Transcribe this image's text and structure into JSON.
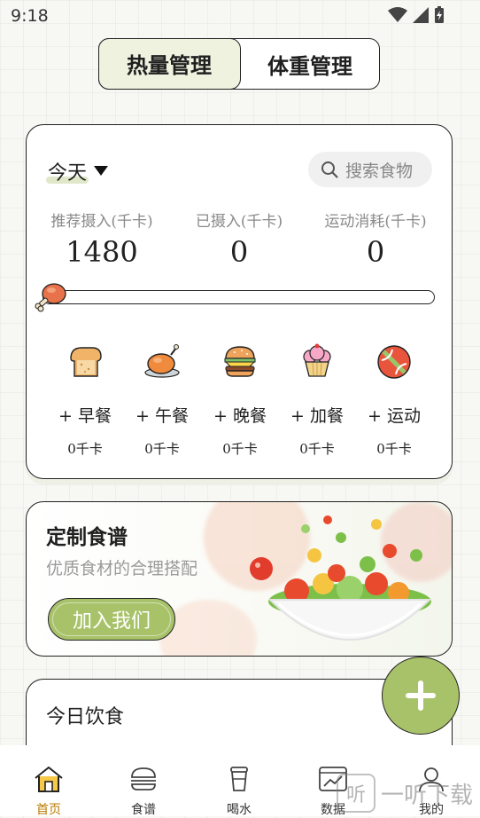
{
  "status_bar": {
    "time": "9:18"
  },
  "segmented": {
    "calorie_label": "热量管理",
    "weight_label": "体重管理"
  },
  "summary": {
    "date_label": "今天",
    "search_placeholder": "搜索食物",
    "recommended_label": "推荐摄入(千卡)",
    "recommended_value": "1480",
    "intake_label": "已摄入(千卡)",
    "intake_value": "0",
    "burned_label": "运动消耗(千卡)",
    "burned_value": "0",
    "progress": 0
  },
  "meals": [
    {
      "label": "+ 早餐",
      "kcal": "0千卡",
      "icon": "bread-icon"
    },
    {
      "label": "+ 午餐",
      "kcal": "0千卡",
      "icon": "roast-chicken-icon"
    },
    {
      "label": "+ 晚餐",
      "kcal": "0千卡",
      "icon": "burger-icon"
    },
    {
      "label": "+ 加餐",
      "kcal": "0千卡",
      "icon": "cupcake-icon"
    },
    {
      "label": "+ 运动",
      "kcal": "0千卡",
      "icon": "ball-icon"
    }
  ],
  "recipe": {
    "title": "定制食谱",
    "subtitle": "优质食材的合理搭配",
    "button": "加入我们"
  },
  "diet": {
    "title": "今日饮食"
  },
  "tabs": [
    {
      "label": "首页",
      "icon": "home-icon"
    },
    {
      "label": "食谱",
      "icon": "burger-outline-icon"
    },
    {
      "label": "喝水",
      "icon": "cup-icon"
    },
    {
      "label": "数据",
      "icon": "chart-icon"
    },
    {
      "label": "我的",
      "icon": "user-icon"
    }
  ],
  "watermark": {
    "glyph": "听",
    "text": "一听下载"
  },
  "colors": {
    "accent": "#a8c26a",
    "accent_light": "#eef2df",
    "border": "#222222"
  }
}
